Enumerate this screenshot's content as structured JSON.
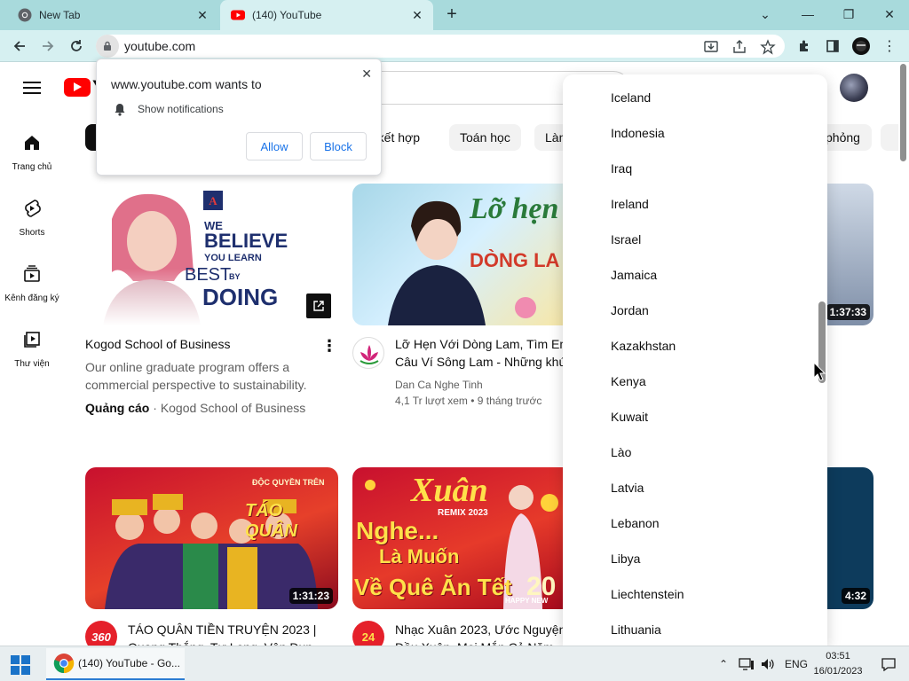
{
  "browser": {
    "tabs": [
      {
        "title": "New Tab",
        "active": false,
        "icon": "chrome-icon"
      },
      {
        "title": "(140) YouTube",
        "active": true,
        "icon": "youtube-icon"
      }
    ],
    "url": "youtube.com",
    "accent": "#a8dadc"
  },
  "youtube": {
    "logo_text": "Y",
    "sidebar": [
      {
        "label": "Trang chủ",
        "icon": "home-icon"
      },
      {
        "label": "Shorts",
        "icon": "shorts-icon"
      },
      {
        "label": "Kênh đăng ký",
        "icon": "subscriptions-icon"
      },
      {
        "label": "Thư viện",
        "icon": "library-icon"
      }
    ],
    "chips": [
      "n kết hợp",
      "Toán học",
      "Làn",
      "phỏng"
    ],
    "videos": [
      {
        "title": "Kogod School of Business",
        "description_line1": "Our online graduate program offers a",
        "description_line2": "commercial perspective to sustainability.",
        "ad_label": "Quảng cáo",
        "ad_separator": "·",
        "advertiser": "Kogod School of Business",
        "thumb_line1": "WE",
        "thumb_line2": "BELIEVE",
        "thumb_line3": "YOU LEARN",
        "thumb_line4": "BEST",
        "thumb_line5": "BY",
        "thumb_line6": "DOING"
      },
      {
        "title_line1": "Lỡ Hẹn Với Dòng Lam, Tìm Em",
        "title_line2": "Câu Ví Sông Lam - Những khú",
        "channel": "Dan Ca Nghe Tinh",
        "stats": "4,1 Tr lượt xem • 9 tháng trước",
        "thumb_line1": "Lỡ hẹn",
        "thumb_line2": "DÒNG LA"
      },
      {
        "duration": "1:37:33"
      },
      {
        "title_line1": "TÁO QUÂN TIỀN TRUYỆN 2023 |",
        "title_line2": "Quang Thắng, Tự Long, Vân Dun",
        "duration": "1:31:23",
        "thumb_line1": "ĐỘC QUYỀN TRÊN",
        "thumb_line2": "TÁO QUÂN",
        "channel_badge": "360"
      },
      {
        "title_line1": "Nhạc Xuân 2023, Ước Nguyện",
        "title_line2": "Đầu Xuân, Mọi Mắn Cả Năm",
        "thumb_line1": "Xuân",
        "thumb_line2": "REMIX 2023",
        "thumb_line3": "Nghe...",
        "thumb_line4": "Là Muốn",
        "thumb_line5": "Về Quê Ăn Tết",
        "thumb_line6": "20",
        "thumb_line7": "HAPPY NEW",
        "channel_badge": "24"
      },
      {
        "duration": "4:32"
      }
    ]
  },
  "notification_prompt": {
    "title": "www.youtube.com wants to",
    "text": "Show notifications",
    "allow": "Allow",
    "block": "Block"
  },
  "country_list": [
    "Iceland",
    "Indonesia",
    "Iraq",
    "Ireland",
    "Israel",
    "Jamaica",
    "Jordan",
    "Kazakhstan",
    "Kenya",
    "Kuwait",
    "Lào",
    "Latvia",
    "Lebanon",
    "Libya",
    "Liechtenstein",
    "Lithuania"
  ],
  "taskbar": {
    "task_title": "(140) YouTube - Go...",
    "language": "ENG",
    "time": "03:51",
    "date": "16/01/2023"
  }
}
